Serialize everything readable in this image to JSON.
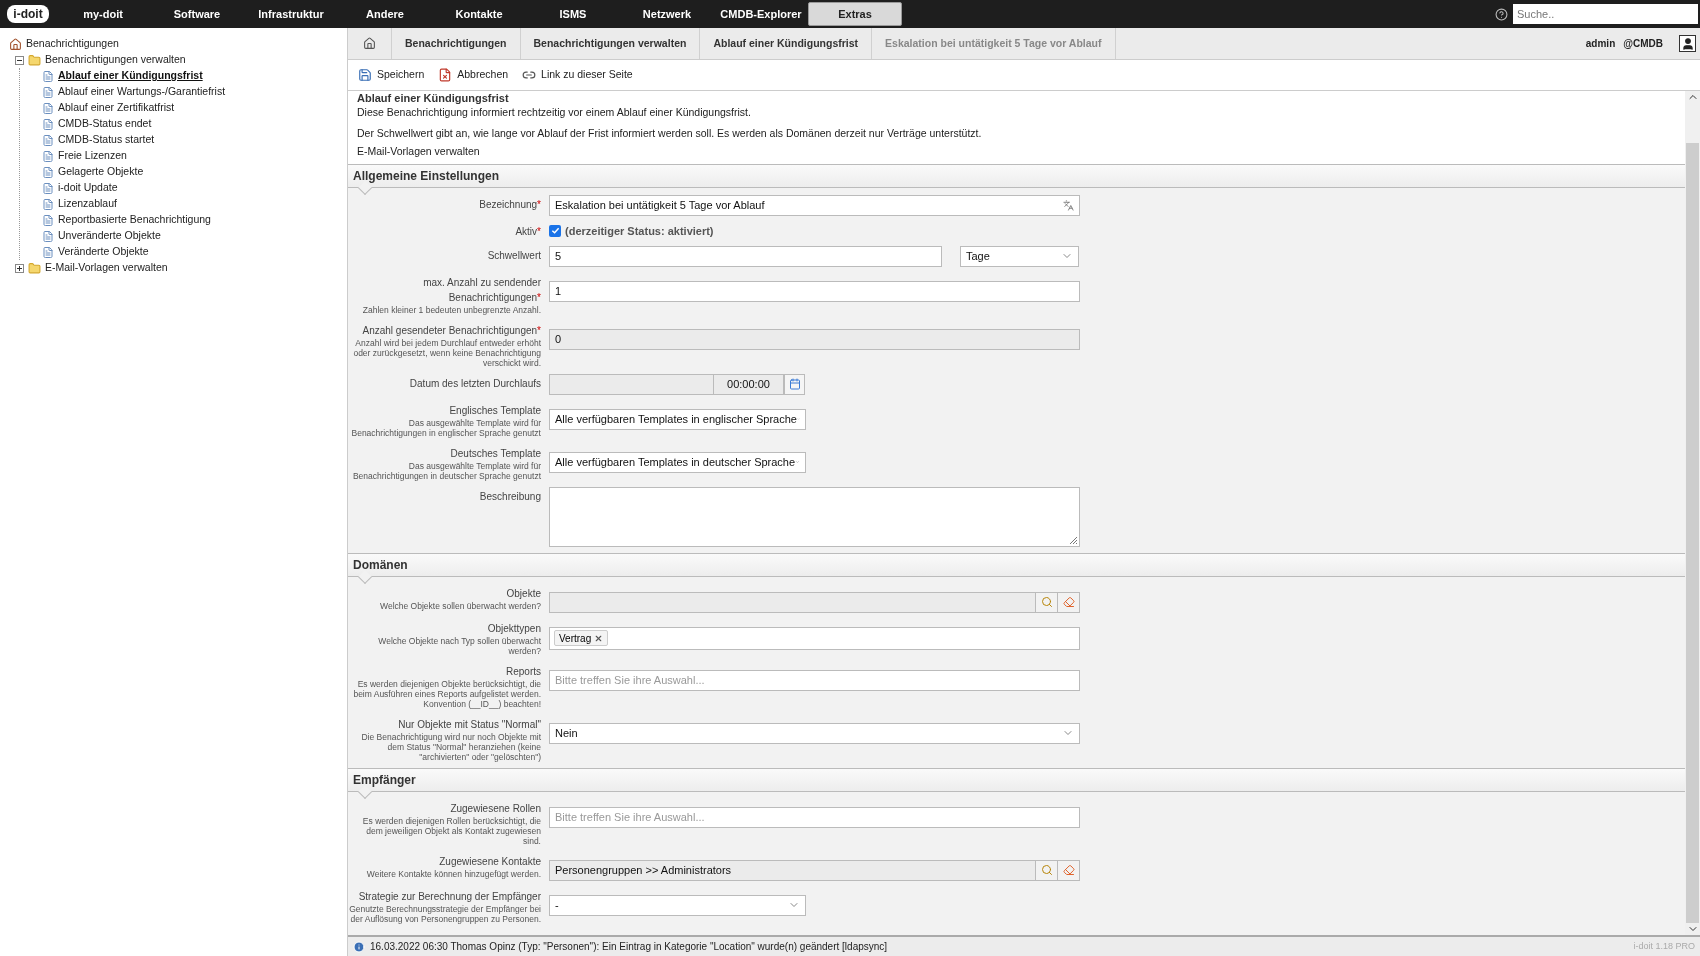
{
  "top_nav": {
    "logo": "i-doit",
    "items": [
      {
        "label": "my-doit",
        "selected": false
      },
      {
        "label": "Software",
        "selected": false
      },
      {
        "label": "Infrastruktur",
        "selected": false
      },
      {
        "label": "Andere",
        "selected": false
      },
      {
        "label": "Kontakte",
        "selected": false
      },
      {
        "label": "ISMS",
        "selected": false
      },
      {
        "label": "Netzwerk",
        "selected": false
      },
      {
        "label": "CMDB-Explorer",
        "selected": false
      },
      {
        "label": "Extras",
        "selected": true
      }
    ],
    "search": {
      "placeholder": "Suche.."
    }
  },
  "sidebar": {
    "tree": [
      {
        "label": "Benachrichtigungen",
        "kind": "home",
        "children": [
          {
            "label": "Benachrichtigungen verwalten",
            "kind": "folder",
            "expanded": true,
            "children": [
              {
                "label": "Ablauf einer Kündigungsfrist",
                "kind": "page",
                "selected": true
              },
              {
                "label": "Ablauf einer Wartungs-/Garantiefrist",
                "kind": "page",
                "selected": false
              },
              {
                "label": "Ablauf einer Zertifikatfrist",
                "kind": "page",
                "selected": false
              },
              {
                "label": "CMDB-Status endet",
                "kind": "page",
                "selected": false
              },
              {
                "label": "CMDB-Status startet",
                "kind": "page",
                "selected": false
              },
              {
                "label": "Freie Lizenzen",
                "kind": "page",
                "selected": false
              },
              {
                "label": "Gelagerte Objekte",
                "kind": "page",
                "selected": false
              },
              {
                "label": "i-doit Update",
                "kind": "page",
                "selected": false
              },
              {
                "label": "Lizenzablauf",
                "kind": "page",
                "selected": false
              },
              {
                "label": "Reportbasierte Benachrichtigung",
                "kind": "page",
                "selected": false
              },
              {
                "label": "Unveränderte Objekte",
                "kind": "page",
                "selected": false
              },
              {
                "label": "Veränderte Objekte",
                "kind": "page",
                "selected": false
              }
            ]
          },
          {
            "label": "E-Mail-Vorlagen verwalten",
            "kind": "folder",
            "expanded": false
          }
        ]
      }
    ]
  },
  "breadcrumb": [
    "Benachrichtigungen",
    "Benachrichtigungen verwalten",
    "Ablauf einer Kündigungsfrist",
    "Eskalation bei untätigkeit 5 Tage vor Ablauf"
  ],
  "user": {
    "name": "admin",
    "context": "@CMDB"
  },
  "toolbar": [
    {
      "label": "Speichern",
      "kind": "save"
    },
    {
      "label": "Abbrechen",
      "kind": "cancel"
    },
    {
      "label": "Link zu dieser Seite",
      "kind": "link"
    }
  ],
  "page": {
    "heading": "Ablauf einer Kündigungsfrist",
    "description": [
      "Diese Benachrichtigung informiert rechtzeitig vor einem Ablauf einer Kündigungsfrist.",
      "Der Schwellwert gibt an, wie lange vor Ablauf der Frist informiert werden soll. Es werden als Domänen derzeit nur Verträge unterstützt."
    ],
    "link": "E-Mail-Vorlagen verwalten"
  },
  "sections": [
    {
      "title": "Allgemeine Einstellungen",
      "fields": [
        {
          "kind": "text-with-icon",
          "label": "Bezeichnung",
          "required_mark": "*",
          "value": "Eskalation bei untätigkeit 5 Tage vor Ablauf"
        },
        {
          "kind": "checkbox",
          "label": "Aktiv",
          "required_mark": "*",
          "checked": true,
          "text": "(derzeitiger Status: aktiviert)"
        },
        {
          "kind": "value-unit",
          "label": "Schwellwert",
          "value": "5",
          "unit": "Tage"
        },
        {
          "kind": "text",
          "label": "max. Anzahl zu sendender Benachrichtigungen",
          "required_mark": "*",
          "hint": "Zahlen kleiner 1 bedeuten unbegrenzte Anzahl.",
          "value": "1"
        },
        {
          "kind": "readonly",
          "label": "Anzahl gesendeter Benachrichtigungen",
          "required_mark": "*",
          "hint": "Anzahl wird bei jedem Durchlauf entweder erhöht oder zurückgesetzt, wenn keine Benachrichtigung verschickt wird.",
          "value": "0"
        },
        {
          "kind": "datetime",
          "label": "Datum des letzten Durchlaufs",
          "time": "00:00:00"
        },
        {
          "kind": "select",
          "label": "Englisches Template",
          "hint": "Das ausgewählte Template wird für Benachrichtigungen in englischer Sprache genutzt",
          "value": "Alle verfügbaren Templates in englischer Sprache"
        },
        {
          "kind": "select",
          "label": "Deutsches Template",
          "hint": "Das ausgewählte Template wird für Benachrichtigungen in deutscher Sprache genutzt",
          "value": "Alle verfügbaren Templates in deutscher Sprache"
        },
        {
          "kind": "textarea",
          "label": "Beschreibung"
        }
      ]
    },
    {
      "title": "Domänen",
      "fields": [
        {
          "kind": "browser",
          "label": "Objekte",
          "hint": "Welche Objekte sollen überwacht werden?"
        },
        {
          "kind": "tags",
          "label": "Objekttypen",
          "hint": "Welche Objekte nach Typ sollen überwacht werden?",
          "tags": [
            "Vertrag"
          ]
        },
        {
          "kind": "multiselect",
          "label": "Reports",
          "hint": "Es werden diejenigen Objekte berücksichtigt, die beim Ausführen eines Reports aufgelistet werden. Konvention (__ID__) beachten!",
          "placeholder": "Bitte treffen Sie ihre Auswahl..."
        },
        {
          "kind": "select-wide",
          "label": "Nur Objekte mit Status \"Normal\"",
          "hint": "Die Benachrichtigung wird nur noch Objekte mit dem Status \"Normal\" heranziehen (keine \"archivierten\" oder \"gelöschten\")",
          "value": "Nein"
        }
      ]
    },
    {
      "title": "Empfänger",
      "fields": [
        {
          "kind": "multiselect",
          "label": "Zugewiesene Rollen",
          "hint": "Es werden diejenigen Rollen berücksichtigt, die dem jeweiligen Objekt als Kontakt zugewiesen sind.",
          "placeholder": "Bitte treffen Sie ihre Auswahl..."
        },
        {
          "kind": "browser",
          "label": "Zugewiesene Kontakte",
          "hint": "Weitere Kontakte können hinzugefügt werden.",
          "value": "Personengruppen >> Administrators"
        },
        {
          "kind": "select",
          "label": "Strategie zur Berechnung der Empfänger",
          "hint": "Genutzte Berechnungsstrategie der Empfänger bei der Auflösung von Personengruppen zu Personen.",
          "value": "-"
        }
      ]
    }
  ],
  "status_bar": {
    "message": "16.03.2022 06:30 Thomas Opinz (Typ: \"Personen\"): Ein Eintrag in Kategorie \"Location\" wurde(n) geändert [ldapsync]",
    "version": "i-doit 1.18 PRO"
  }
}
